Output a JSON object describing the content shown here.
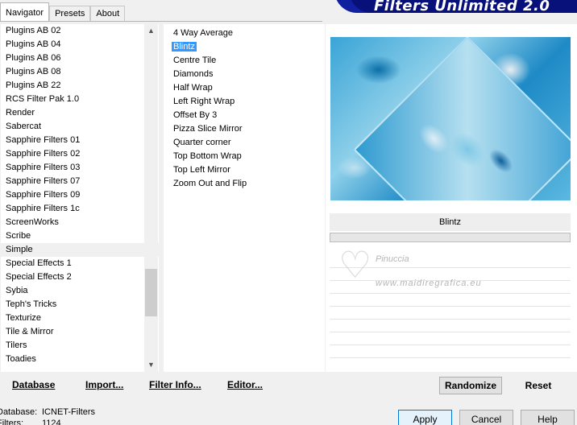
{
  "tabs": [
    {
      "label": "Navigator"
    },
    {
      "label": "Presets"
    },
    {
      "label": "About"
    }
  ],
  "banner_title": "Filters Unlimited 2.0",
  "categories": [
    "Plugins AB 02",
    "Plugins AB 04",
    "Plugins AB 06",
    "Plugins AB 08",
    "Plugins AB 22",
    "RCS Filter Pak 1.0",
    "Render",
    "Sabercat",
    "Sapphire Filters 01",
    "Sapphire Filters 02",
    "Sapphire Filters 03",
    "Sapphire Filters 07",
    "Sapphire Filters 09",
    "Sapphire Filters 1c",
    "ScreenWorks",
    "Scribe",
    "Simple",
    "Special Effects 1",
    "Special Effects 2",
    "Sybia",
    "Teph's Tricks",
    "Texturize",
    "Tile & Mirror",
    "Tilers",
    "Toadies"
  ],
  "selected_category": "Simple",
  "filters": [
    "4 Way Average",
    "Blintz",
    "Centre Tile",
    "Diamonds",
    "Half Wrap",
    "Left Right Wrap",
    "Offset By 3",
    "Pizza Slice Mirror",
    "Quarter corner",
    "Top Bottom Wrap",
    "Top Left Mirror",
    "Zoom Out and Flip"
  ],
  "selected_filter": "Blintz",
  "param_header": "Blintz",
  "watermark": {
    "name": "Pinuccia",
    "url": "www.maidiregrafica.eu"
  },
  "bottom_buttons": {
    "database": "Database",
    "import": "Import...",
    "filter_info": "Filter Info...",
    "editor": "Editor..."
  },
  "randomize": "Randomize",
  "reset": "Reset",
  "status": {
    "database_label": "Database:",
    "database_value": "ICNET-Filters",
    "filters_label": "Filters:",
    "filters_value": "1124"
  },
  "dialog_buttons": {
    "apply": "Apply",
    "cancel": "Cancel",
    "help": "Help"
  },
  "icons": {
    "scroll_up": "▲",
    "scroll_down": "▼",
    "heart": "♡"
  }
}
